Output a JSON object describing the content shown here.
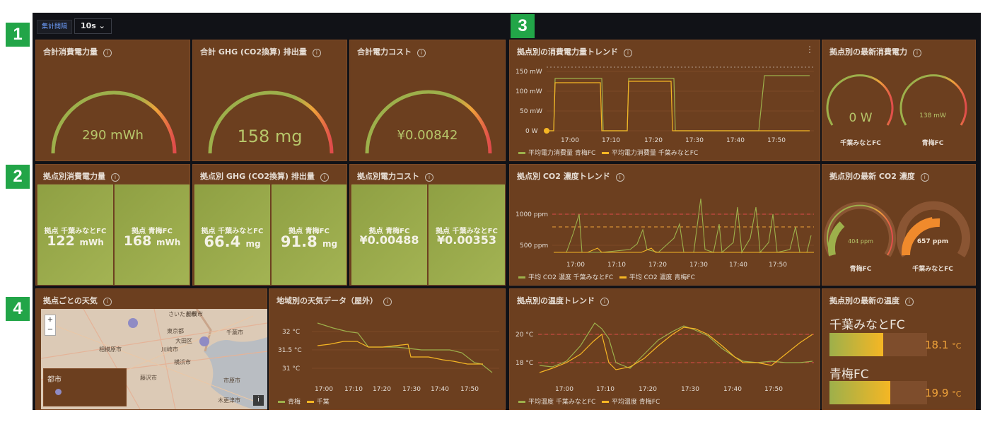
{
  "toolbar": {
    "variable_label": "集計間隔",
    "interval_value": "10s ⌄"
  },
  "badges": [
    "1",
    "2",
    "3",
    "4"
  ],
  "row1": {
    "panels": [
      {
        "title": "合計消費電力量",
        "value": "290 mWh"
      },
      {
        "title": "合計 GHG (CO2換算) 排出量",
        "value": "158 mg"
      },
      {
        "title": "合計電力コスト",
        "value": "¥0.00842"
      }
    ]
  },
  "row2": {
    "panels": [
      {
        "title": "拠点別消費電力量",
        "stats": [
          {
            "label": "拠点 千葉みなとFC",
            "value": "122",
            "unit": "mWh"
          },
          {
            "label": "拠点 青梅FC",
            "value": "168",
            "unit": "mWh"
          }
        ]
      },
      {
        "title": "拠点別 GHG (CO2換算) 排出量",
        "stats": [
          {
            "label": "拠点 千葉みなとFC",
            "value": "66.4",
            "unit": "mg"
          },
          {
            "label": "拠点 青梅FC",
            "value": "91.8",
            "unit": "mg"
          }
        ]
      },
      {
        "title": "拠点別電力コスト",
        "stats": [
          {
            "label": "拠点 青梅FC",
            "value": "¥0.00488",
            "unit": ""
          },
          {
            "label": "拠点 千葉みなとFC",
            "value": "¥0.00353",
            "unit": ""
          }
        ]
      }
    ]
  },
  "power_trend": {
    "title": "拠点別の消費電力量トレンド",
    "yticks": [
      "150 mW",
      "100 mW",
      "50 mW",
      "0 W"
    ],
    "xticks": [
      "17:00",
      "17:10",
      "17:20",
      "17:30",
      "17:40",
      "17:50"
    ],
    "legend": [
      "平均電力消費量 青梅FC",
      "平均電力消費量 千葉みなとFC"
    ]
  },
  "power_latest": {
    "title": "拠点別の最新消費電力",
    "gauges": [
      {
        "value": "0 W",
        "label": "千葉みなとFC",
        "fraction": 0.0
      },
      {
        "value": "138 mW",
        "label": "青梅FC",
        "fraction": 0.0
      }
    ]
  },
  "co2_trend": {
    "title": "拠点別 CO2 濃度トレンド",
    "yticks": [
      "1000 ppm",
      "500 ppm"
    ],
    "xticks": [
      "17:00",
      "17:10",
      "17:20",
      "17:30",
      "17:40",
      "17:50"
    ],
    "legend": [
      "平均 CO2 濃度 千葉みなとFC",
      "平均 CO2 濃度 青梅FC"
    ]
  },
  "co2_latest": {
    "title": "拠点別の最新 CO2 濃度",
    "gauges": [
      {
        "value": "404 ppm",
        "label": "青梅FC"
      },
      {
        "value": "657 ppm",
        "label": "千葉みなとFC"
      }
    ]
  },
  "weather_map": {
    "title": "拠点ごとの天気",
    "zoom_in": "+",
    "zoom_out": "−",
    "legend_title": "都市",
    "labels": [
      "さいたま市",
      "船橋市",
      "東京都",
      "相模原市",
      "川崎市",
      "横浜市",
      "藤沢市",
      "千葉市",
      "大田区",
      "市原市",
      "木更津市"
    ],
    "info": "i"
  },
  "outdoor_weather": {
    "title": "地域別の天気データ（屋外）",
    "yticks": [
      "32 °C",
      "31.5 °C",
      "31 °C"
    ],
    "xticks": [
      "17:00",
      "17:10",
      "17:20",
      "17:30",
      "17:40",
      "17:50"
    ],
    "legend": [
      "青梅",
      "千葉"
    ]
  },
  "temp_trend": {
    "title": "拠点別の温度トレンド",
    "yticks": [
      "20 °C",
      "18 °C"
    ],
    "xticks": [
      "17:00",
      "17:10",
      "17:20",
      "17:30",
      "17:40",
      "17:50"
    ],
    "legend": [
      "平均温度 千葉みなとFC",
      "平均温度 青梅FC"
    ]
  },
  "temp_latest": {
    "title": "拠点別の最新の温度",
    "items": [
      {
        "label": "千葉みなとFC",
        "value": "18.1",
        "unit": "°C",
        "fraction": 0.55
      },
      {
        "label": "青梅FC",
        "value": "19.9",
        "unit": "°C",
        "fraction": 0.62
      }
    ]
  },
  "colors": {
    "panel": "#6c3f1f",
    "series_green": "#9db04b",
    "series_yellow": "#f5b624",
    "threshold": "#e04b4b"
  }
}
